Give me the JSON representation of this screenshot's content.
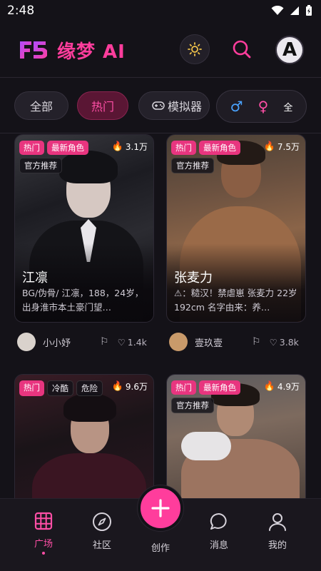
{
  "status_bar": {
    "time": "2:48"
  },
  "header": {
    "app_title": "缘梦 AI",
    "avatar_letter": "A"
  },
  "tabs": {
    "all": "全部",
    "hot": "热门",
    "simulator": "模拟器",
    "gender_all": "全",
    "active": "热门"
  },
  "cards": [
    {
      "badges": [
        "热门",
        "最新角色"
      ],
      "extra_badges": [
        "官方推荐"
      ],
      "heat": "3.1万",
      "name": "江凛",
      "desc": "BG/伪骨/ 江凛，188，24岁，出身淮市本土豪门望…",
      "author": "小小妤",
      "likes": "1.4k"
    },
    {
      "badges": [
        "热门",
        "最新角色"
      ],
      "extra_badges": [
        "官方推荐"
      ],
      "heat": "7.5万",
      "name": "张麦力",
      "desc": "⚠：糙汉！禁虐崽 张麦力 22岁 192cm 名字由来：养…",
      "author": "壹玖壹",
      "likes": "3.8k"
    },
    {
      "badges": [
        "热门",
        "冷酷"
      ],
      "extra_badges": [
        "危险"
      ],
      "heat": "9.6万"
    },
    {
      "badges": [
        "热门",
        "最新角色"
      ],
      "extra_badges": [
        "官方推荐"
      ],
      "heat": "4.9万"
    }
  ],
  "nav": {
    "plaza": "广场",
    "community": "社区",
    "create": "创作",
    "messages": "消息",
    "mine": "我的",
    "active": "广场"
  },
  "colors": {
    "accent": "#ff3d9c",
    "background": "#141218",
    "badge_pink": "#e8357f",
    "male": "#4aa3ff"
  }
}
